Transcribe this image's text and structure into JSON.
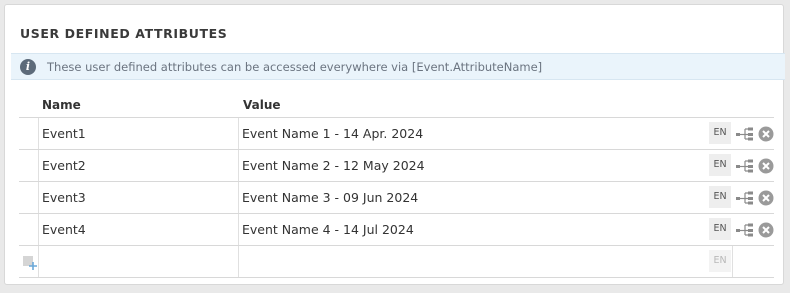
{
  "section": {
    "title": "USER DEFINED ATTRIBUTES",
    "info_text": "These user defined attributes can be accessed everywhere via [Event.AttributeName]"
  },
  "table": {
    "columns": [
      "Name",
      "Value"
    ],
    "rows": [
      {
        "name": "Event1",
        "value": "Event Name 1 - 14 Apr. 2024",
        "lang": "EN"
      },
      {
        "name": "Event2",
        "value": "Event Name 2 - 12 May 2024",
        "lang": "EN"
      },
      {
        "name": "Event3",
        "value": "Event Name 3 - 09 Jun 2024",
        "lang": "EN"
      },
      {
        "name": "Event4",
        "value": "Event Name 4 - 14 Jul 2024",
        "lang": "EN"
      }
    ],
    "new_row": {
      "name": "",
      "value": "",
      "lang": "EN"
    }
  },
  "icons": {
    "info": "info-icon",
    "tree": "tree-structure-icon",
    "remove": "remove-circle-icon",
    "add": "add-row-icon"
  },
  "colors": {
    "info_bg": "#eaf4fb",
    "remove_icon": "#9a9a9a",
    "tree_icon": "#8a8a8a"
  }
}
